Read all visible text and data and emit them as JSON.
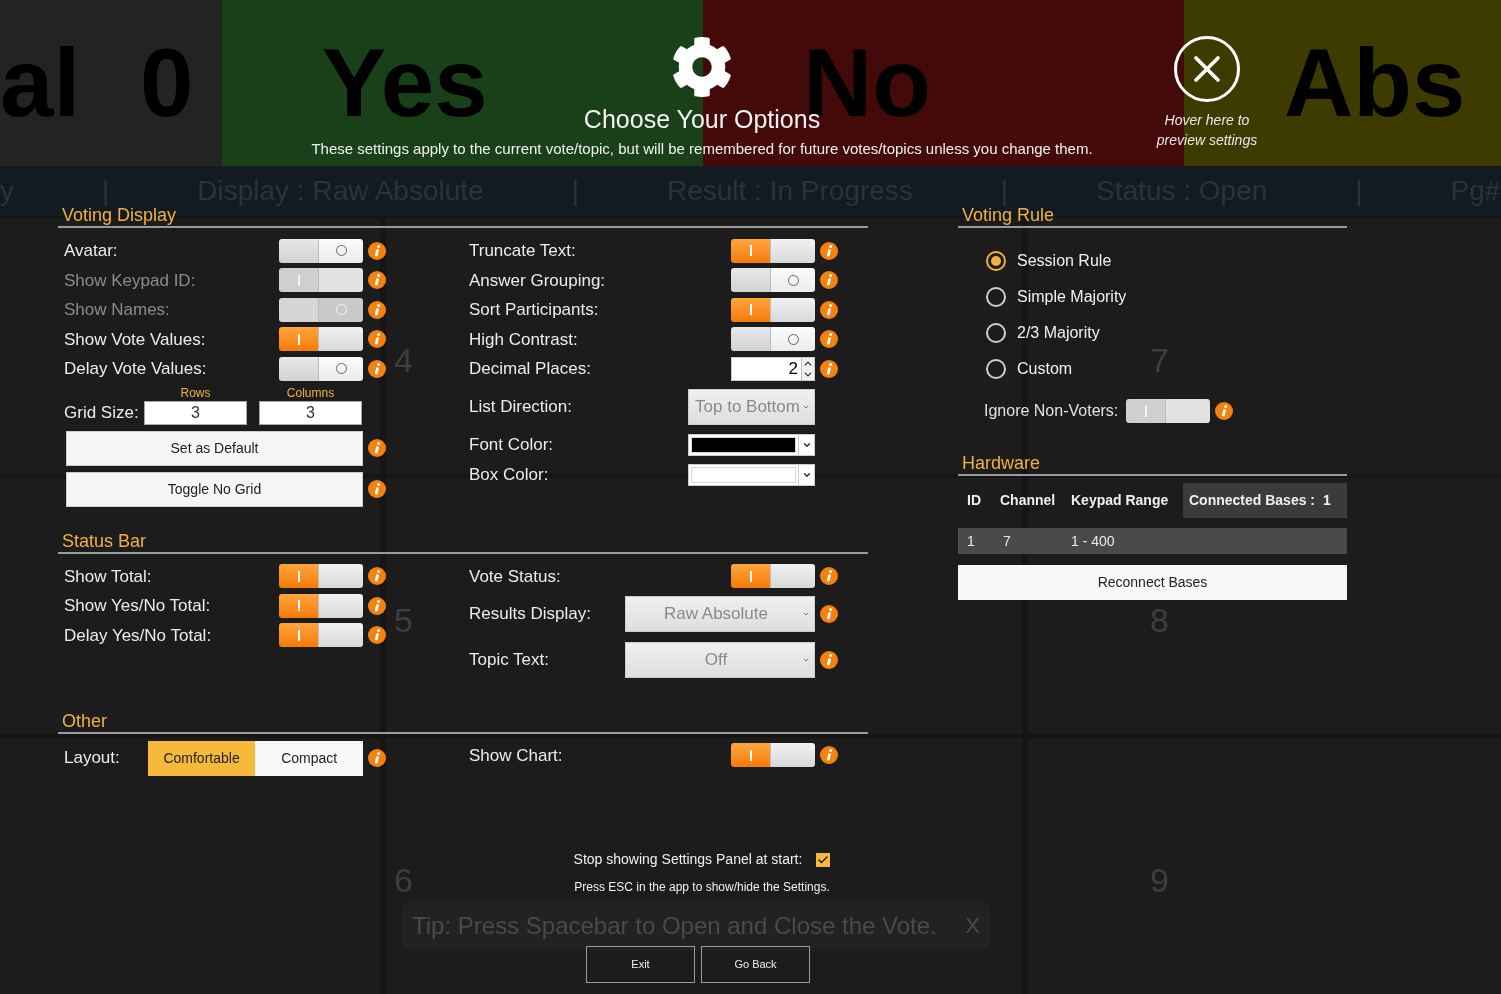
{
  "background": {
    "tiles": [
      {
        "texts": [
          "al",
          "0"
        ],
        "color": "#232323"
      },
      {
        "texts": [
          "Yes"
        ],
        "color": "#1a401a"
      },
      {
        "texts": [
          "No"
        ],
        "color": "#440a0a"
      },
      {
        "texts": [
          "Abs"
        ],
        "color": "#3e3b00"
      }
    ],
    "status_items": [
      "y",
      "|",
      "Display : Raw Absolute",
      "|",
      "Result : In Progress",
      "|",
      "Status : Open",
      "|",
      "Pg#"
    ],
    "grid_numbers": [
      "4",
      "5",
      "6",
      "7",
      "8",
      "9"
    ],
    "tip": {
      "text": "Tip: Press Spacebar to Open and Close the Vote.",
      "close": "X"
    }
  },
  "header": {
    "title": "Choose Your Options",
    "subtitle": "These settings apply to the current vote/topic, but will be remembered for future votes/topics unless you change them.",
    "preview_hint": "Hover here to preview settings"
  },
  "voting_display": {
    "title": "Voting Display",
    "left_rows": [
      {
        "kind": "toggle",
        "label": "Avatar:",
        "on": false,
        "disabled": false,
        "info": true
      },
      {
        "kind": "toggle",
        "label": "Show Keypad ID:",
        "on": true,
        "disabled": true,
        "info": true
      },
      {
        "kind": "toggle",
        "label": "Show Names:",
        "on": false,
        "disabled": true,
        "info": true
      },
      {
        "kind": "toggle",
        "label": "Show Vote Values:",
        "on": true,
        "disabled": false,
        "info": true
      },
      {
        "kind": "toggle",
        "label": "Delay Vote Values:",
        "on": false,
        "disabled": false,
        "info": true
      }
    ],
    "grid_size": {
      "label": "Grid Size:",
      "fields": [
        {
          "caption": "Rows",
          "value": "3"
        },
        {
          "caption": "Columns",
          "value": "3"
        }
      ]
    },
    "buttons": [
      {
        "label": "Set as Default",
        "info": true
      },
      {
        "label": "Toggle No Grid",
        "info": true
      }
    ],
    "right_rows": [
      {
        "kind": "toggle",
        "label": "Truncate Text:",
        "on": true,
        "disabled": false,
        "info": true
      },
      {
        "kind": "toggle",
        "label": "Answer Grouping:",
        "on": false,
        "disabled": false,
        "info": true
      },
      {
        "kind": "toggle",
        "label": "Sort Participants:",
        "on": true,
        "disabled": false,
        "info": true
      },
      {
        "kind": "toggle",
        "label": "High Contrast:",
        "on": false,
        "disabled": false,
        "info": true
      },
      {
        "kind": "number",
        "label": "Decimal Places:",
        "value": "2",
        "info": true
      },
      {
        "kind": "dropdown",
        "label": "List Direction:",
        "value": "Top to Bottom",
        "info": false
      },
      {
        "kind": "color",
        "label": "Font Color:",
        "color": "#000000",
        "info": false
      },
      {
        "kind": "color",
        "label": "Box Color:",
        "color": "#ffffff",
        "info": false
      }
    ]
  },
  "status_bar": {
    "title": "Status Bar",
    "left_rows": [
      {
        "kind": "toggle",
        "label": "Show Total:",
        "on": true,
        "disabled": false,
        "info": true
      },
      {
        "kind": "toggle",
        "label": "Show Yes/No Total:",
        "on": true,
        "disabled": false,
        "info": true
      },
      {
        "kind": "toggle",
        "label": "Delay Yes/No Total:",
        "on": true,
        "disabled": false,
        "info": true
      }
    ],
    "right_rows": [
      {
        "kind": "toggle",
        "label": "Vote Status:",
        "on": true,
        "disabled": false,
        "info": true
      },
      {
        "kind": "dropdown",
        "label": "Results Display:",
        "value": "Raw Absolute",
        "info": true
      },
      {
        "kind": "dropdown",
        "label": "Topic Text:",
        "value": "Off",
        "info": true
      }
    ]
  },
  "other": {
    "title": "Other",
    "layout": {
      "label": "Layout:",
      "options": [
        {
          "label": "Comfortable",
          "selected": true
        },
        {
          "label": "Compact",
          "selected": false
        }
      ],
      "info": true
    },
    "right_rows": [
      {
        "kind": "toggle",
        "label": "Show Chart:",
        "on": true,
        "disabled": false,
        "info": true
      }
    ]
  },
  "voting_rule": {
    "title": "Voting Rule",
    "options": [
      {
        "label": "Session Rule",
        "selected": true
      },
      {
        "label": "Simple Majority",
        "selected": false
      },
      {
        "label": "2/3 Majority",
        "selected": false
      },
      {
        "label": "Custom",
        "selected": false
      }
    ],
    "ignore_non_voters": {
      "label": "Ignore Non-Voters:",
      "on": true,
      "disabled": true,
      "info": true
    }
  },
  "hardware": {
    "title": "Hardware",
    "columns": [
      "ID",
      "Channel",
      "Keypad Range"
    ],
    "connected_label": "Connected Bases :",
    "connected_value": "1",
    "rows": [
      [
        "1",
        "7",
        "1 - 400"
      ]
    ],
    "button": "Reconnect Bases"
  },
  "footer": {
    "stop_label": "Stop showing Settings Panel at start:",
    "stop_checked": true,
    "hint": "Press ESC in the app to show/hide the Settings.",
    "buttons": [
      "Exit",
      "Go Back"
    ]
  }
}
